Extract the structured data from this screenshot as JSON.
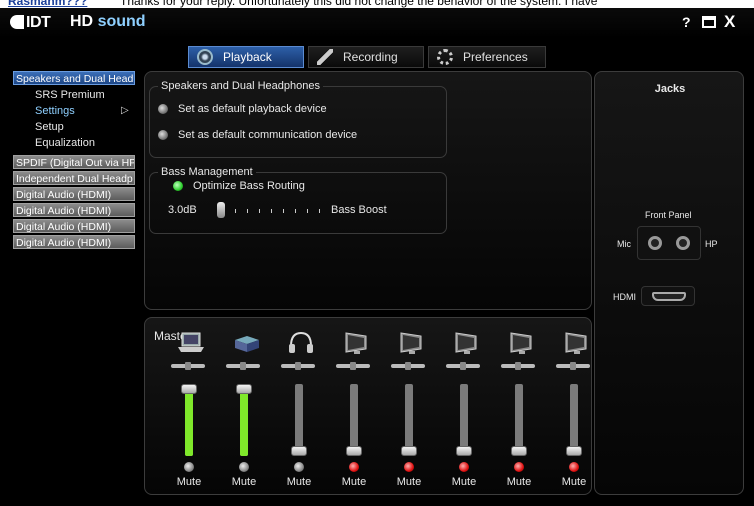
{
  "behind_window": {
    "link_text": "Rasmanm???",
    "text": "Thanks for your reply. Unfortunately this did not change the behavior of the system. I have"
  },
  "app": {
    "logo": "IDT",
    "title_prefix": "HD",
    "title_suffix": "sound",
    "help": "?",
    "close": "X"
  },
  "tabs": [
    {
      "label": "Playback",
      "icon": "speaker-icon",
      "active": true
    },
    {
      "label": "Recording",
      "icon": "microphone-icon",
      "active": false
    },
    {
      "label": "Preferences",
      "icon": "gear-icon",
      "active": false
    }
  ],
  "devices": [
    {
      "label": "Speakers and Dual Head",
      "selected": true
    },
    {
      "label": "SPDIF (Digital Out via HP",
      "selected": false
    },
    {
      "label": "Independent Dual Headp",
      "selected": false
    },
    {
      "label": "Digital Audio (HDMI)",
      "selected": false
    },
    {
      "label": "Digital Audio (HDMI)",
      "selected": false
    },
    {
      "label": "Digital Audio (HDMI)",
      "selected": false
    },
    {
      "label": "Digital Audio (HDMI)",
      "selected": false
    }
  ],
  "subitems": [
    {
      "label": "SRS Premium",
      "selected": false
    },
    {
      "label": "Settings",
      "selected": true,
      "arrow": "▷"
    },
    {
      "label": "Setup",
      "selected": false
    },
    {
      "label": "Equalization",
      "selected": false
    }
  ],
  "settings": {
    "group_title": "Speakers and Dual Headphones",
    "default_playback": "Set as default playback device",
    "default_communication": "Set as default communication device"
  },
  "bass": {
    "group_title": "Bass Management",
    "optimize_label": "Optimize Bass Routing",
    "optimize_on": true,
    "value_text": "3.0dB",
    "level": 0.0,
    "boost_label": "Bass Boost"
  },
  "mixer": {
    "master_label": "Master",
    "mute_label": "Mute",
    "channels": [
      {
        "icon": "laptop-icon",
        "level": 1.0,
        "active": true,
        "muted": false
      },
      {
        "icon": "speaker-box-icon",
        "level": 1.0,
        "active": true,
        "muted": false
      },
      {
        "icon": "headphones-icon",
        "level": 0.0,
        "active": false,
        "muted": false
      },
      {
        "icon": "monitor-icon",
        "level": 0.0,
        "active": false,
        "muted": true
      },
      {
        "icon": "monitor-icon",
        "level": 0.0,
        "active": false,
        "muted": true
      },
      {
        "icon": "monitor-icon",
        "level": 0.0,
        "active": false,
        "muted": true
      },
      {
        "icon": "monitor-icon",
        "level": 0.0,
        "active": false,
        "muted": true
      },
      {
        "icon": "monitor-icon",
        "level": 0.0,
        "active": false,
        "muted": true
      }
    ]
  },
  "jacks": {
    "title": "Jacks",
    "front_panel": "Front Panel",
    "mic": "Mic",
    "hp": "HP",
    "hdmi": "HDMI"
  },
  "colors": {
    "accent": "#2d5fa8",
    "level_green": "#7fe82a",
    "mute_red": "#e01010",
    "selected_text": "#8fd0ff"
  }
}
